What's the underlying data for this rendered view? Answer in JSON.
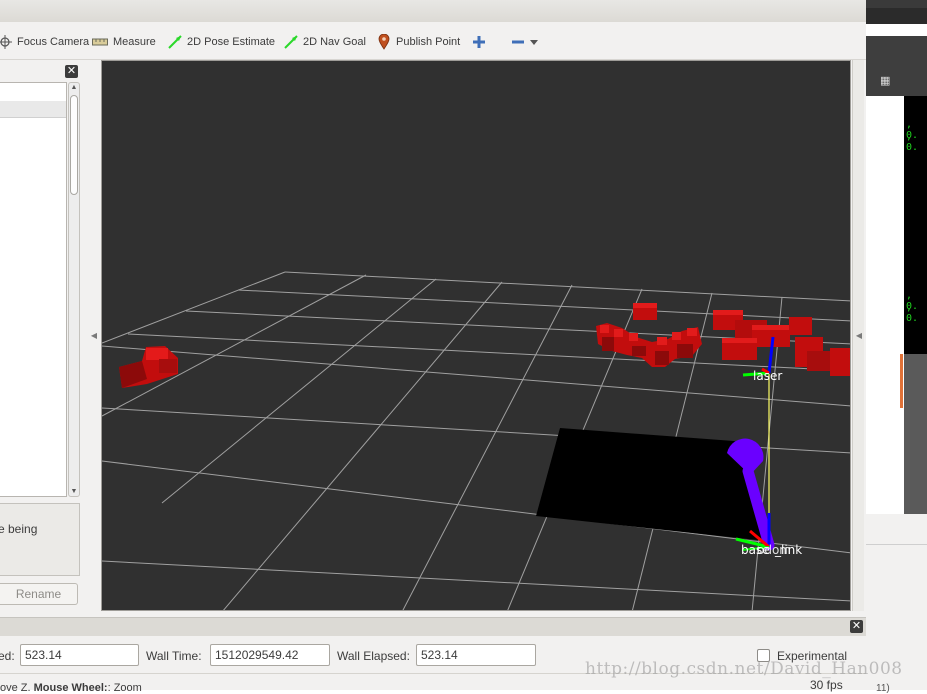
{
  "toolbar": {
    "tools": [
      {
        "label": "Focus Camera",
        "icon": "focus-camera-icon"
      },
      {
        "label": "Measure",
        "icon": "ruler-icon"
      },
      {
        "label": "2D Pose Estimate",
        "icon": "green-arrow-icon"
      },
      {
        "label": "2D Nav Goal",
        "icon": "green-arrow-icon"
      },
      {
        "label": "Publish Point",
        "icon": "map-pin-icon"
      }
    ],
    "add_icon": "plus-icon",
    "remove_icon": "minus-icon",
    "dropdown_icon": "chevron-down-icon"
  },
  "left_panel": {
    "description_text": "e being",
    "rename_label": "Rename"
  },
  "view3d": {
    "background": "#303030",
    "labels": {
      "laser": "laser",
      "base_a": "base",
      "base_b": "_link",
      "odom": "odom"
    }
  },
  "time_panel": {
    "ros_elapsed_label": "ed:",
    "ros_elapsed_value": "523.14",
    "wall_time_label": "Wall Time:",
    "wall_time_value": "1512029549.42",
    "wall_elapsed_label": "Wall Elapsed:",
    "wall_elapsed_value": "523.14",
    "experimental_label": "Experimental"
  },
  "status_bar": {
    "hint_prefix": "ove Z. ",
    "hint_bold": "Mouse Wheel:",
    "hint_suffix": ": Zoom",
    "fps": "30 fps"
  },
  "terminal": {
    "lines": [
      ", 0.",
      ", 0.",
      ", 0.",
      ", 0."
    ],
    "partial_tail": "11)"
  },
  "watermark": "http://blog.csdn.net/David_Han008",
  "colors": {
    "point_cloud": "#cc1010",
    "axis_red": "#ff0000",
    "axis_green": "#00ff00",
    "axis_blue": "#0000ff",
    "robot_arrow": "#6a00ff",
    "tf_line": "#ffff66"
  }
}
